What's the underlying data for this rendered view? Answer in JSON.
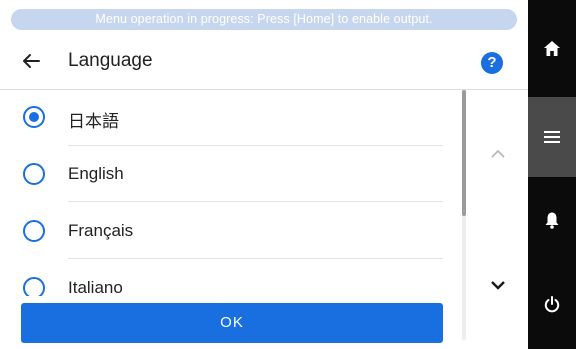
{
  "banner": {
    "text": "Menu operation in progress: Press [Home] to enable output."
  },
  "header": {
    "title": "Language",
    "help_label": "?"
  },
  "languages": [
    {
      "label": "日本語",
      "selected": true
    },
    {
      "label": "English",
      "selected": false
    },
    {
      "label": "Français",
      "selected": false
    },
    {
      "label": "Italiano",
      "selected": false
    }
  ],
  "footer": {
    "ok_label": "OK"
  },
  "side_nav": {
    "items": [
      {
        "icon": "home-icon"
      },
      {
        "icon": "menu-icon",
        "active": true
      },
      {
        "icon": "bell-icon"
      },
      {
        "icon": "power-icon"
      }
    ]
  },
  "colors": {
    "accent": "#1a6fe0",
    "banner_bg": "#c7d6ef",
    "side_nav_bg": "#0b0b0b",
    "side_nav_active": "#4a4a4a"
  }
}
